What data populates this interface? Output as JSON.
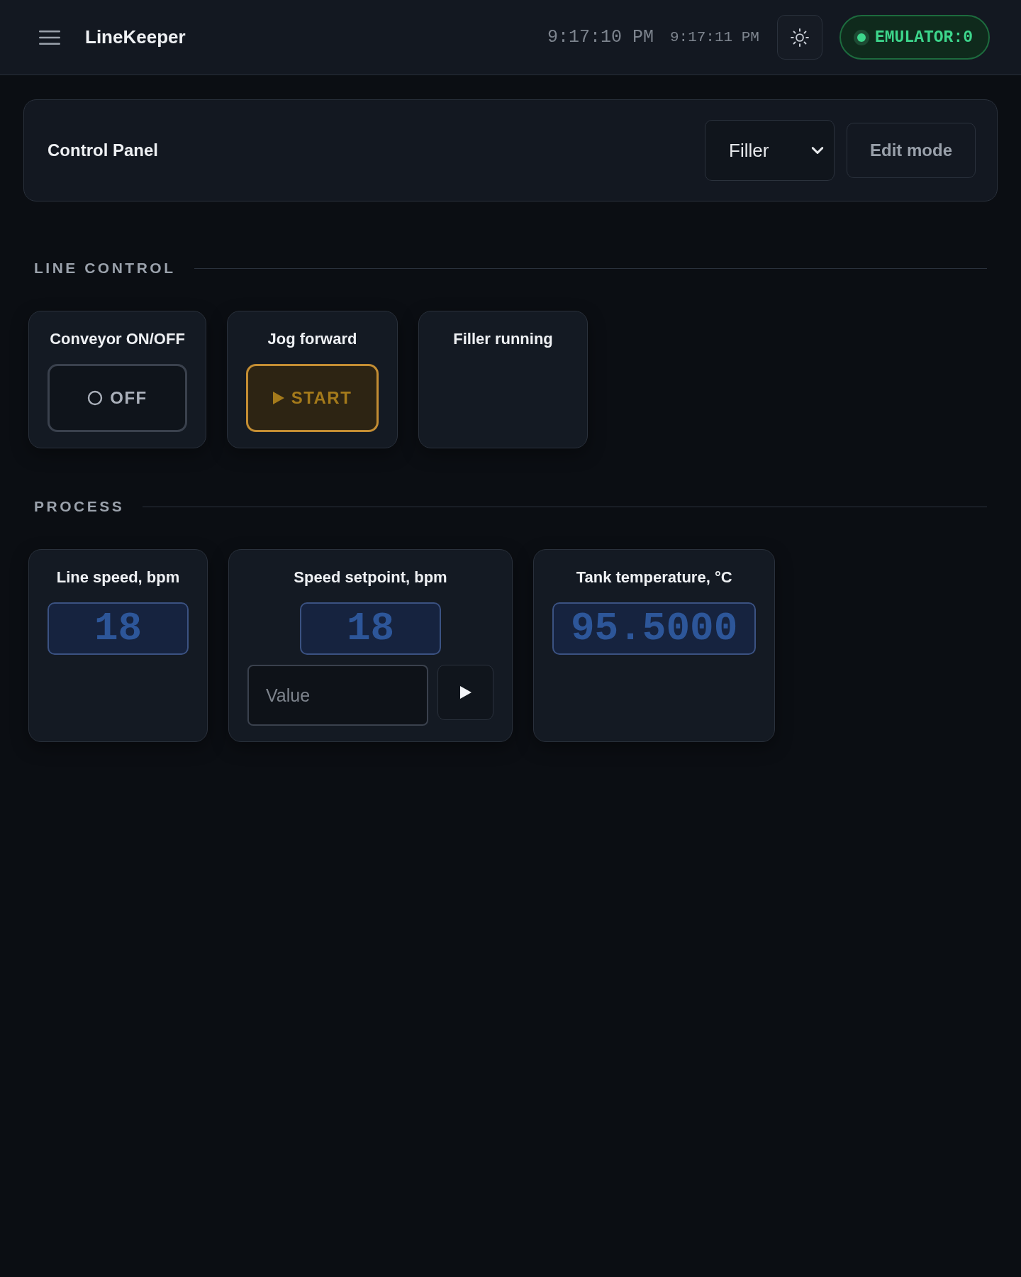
{
  "header": {
    "title": "LineKeeper",
    "clocks": [
      "9:17:10 PM",
      "9:17:11 PM"
    ],
    "connection": {
      "label": "EMULATOR:0",
      "connected": true
    }
  },
  "control_panel": {
    "title": "Control Panel",
    "station_select": {
      "value": "Filler"
    },
    "edit_button": "Edit mode"
  },
  "sections": [
    {
      "title": "LINE CONTROL",
      "widgets": [
        {
          "kind": "toggle",
          "label": "Conveyor ON/OFF",
          "button": "OFF",
          "on": false
        },
        {
          "kind": "momentary",
          "label": "Jog forward",
          "button": "START"
        },
        {
          "kind": "indicator",
          "label": "Filler running"
        }
      ]
    },
    {
      "title": "PROCESS",
      "widgets": [
        {
          "kind": "readout",
          "label": "Line speed, bpm",
          "value": "18"
        },
        {
          "kind": "setpoint",
          "label": "Speed setpoint, bpm",
          "value": "18",
          "input": {
            "placeholder": "Value"
          }
        },
        {
          "kind": "readout",
          "label": "Tank temperature, °C",
          "value": "95.5000"
        }
      ]
    }
  ]
}
